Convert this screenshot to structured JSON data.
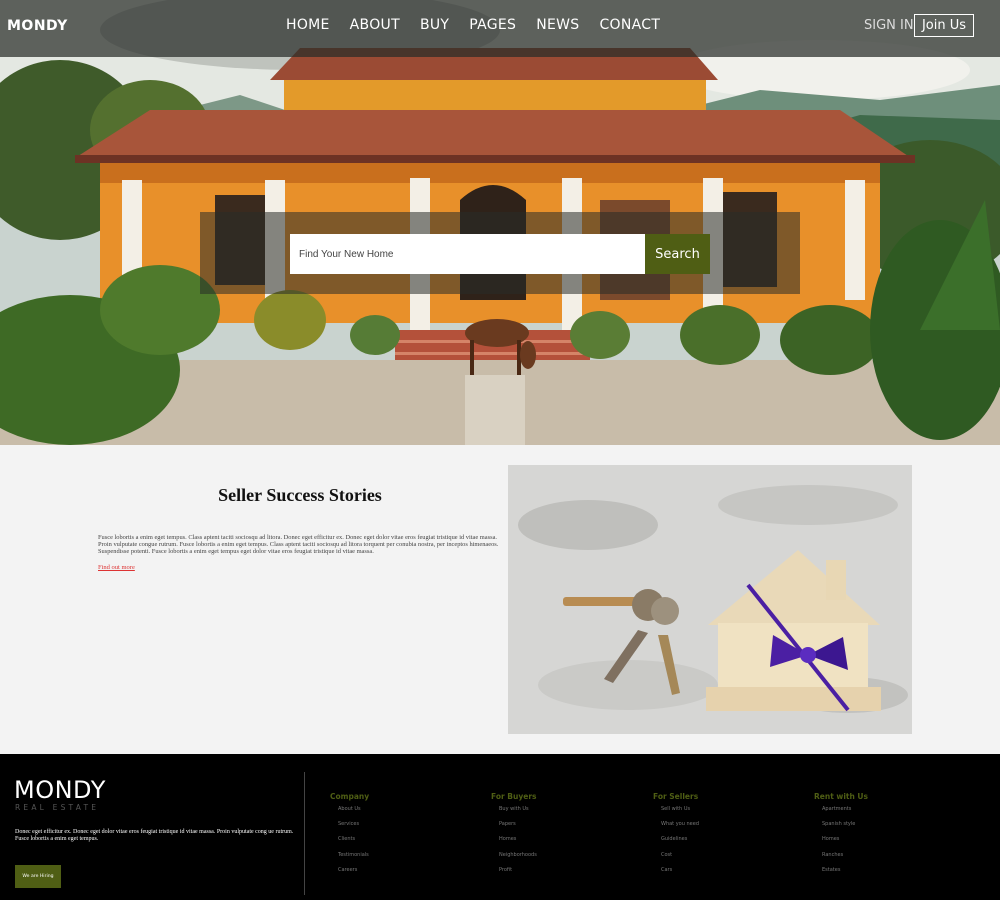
{
  "nav": {
    "logo": "MONDY",
    "menu": [
      "HOME",
      "ABOUT",
      "BUY",
      "PAGES",
      "NEWS",
      "CONACT"
    ],
    "sign_in": "SIGN IN",
    "join": "Join Us"
  },
  "hero": {
    "search_placeholder": "Find Your New Home",
    "search_button": "Search"
  },
  "stories": {
    "title": "Seller Success Stories",
    "body": "Fusce lobortis a enim eget tempus. Class aptent taciti sociosqu ad litora. Donec eget efficitur ex. Donec eget dolor vitae eros feugiat tristique id vitae massa. Proin vulputate congue rutrum. Fusce lobortis a enim eget tempus. Class aptent taciti sociosqu ad litora torquent per conubia nostra, per inceptos himenaeos. Suspendisse potenti. Fusce lobortis a enim eget tempus eget dolor vitae eros feugiat tristique id vitae massa.",
    "link": "Find out more"
  },
  "footer": {
    "logo": "MONDY",
    "tagline": "REAL ESTATE",
    "description": "Donec eget efficitur ex. Donec eget dolor vitae eros feugiat tristique id vitae massa. Proin vulputate cong ue rutrum. Fusce lobortis a enim eget tempus.",
    "hire_button": "We are Hiring",
    "columns": [
      {
        "title": "Company",
        "links": [
          "About Us",
          "Services",
          "Clients",
          "Testimonials",
          "Careers"
        ]
      },
      {
        "title": "For Buyers",
        "links": [
          "Buy with Us",
          "Papers",
          "Homes",
          "Neighborhoods",
          "Profit"
        ]
      },
      {
        "title": "For Sellers",
        "links": [
          "Sell with Us",
          "What you need",
          "Guidelines",
          "Cost",
          "Cars"
        ]
      },
      {
        "title": "Rent with Us",
        "links": [
          "Apartments",
          "Spanish style",
          "Homes",
          "Ranches",
          "Estates"
        ]
      }
    ]
  },
  "colors": {
    "accent": "#4f5e14",
    "nav_bg": "#282c28",
    "footer_bg": "#000000",
    "link_red": "#dd3333"
  }
}
